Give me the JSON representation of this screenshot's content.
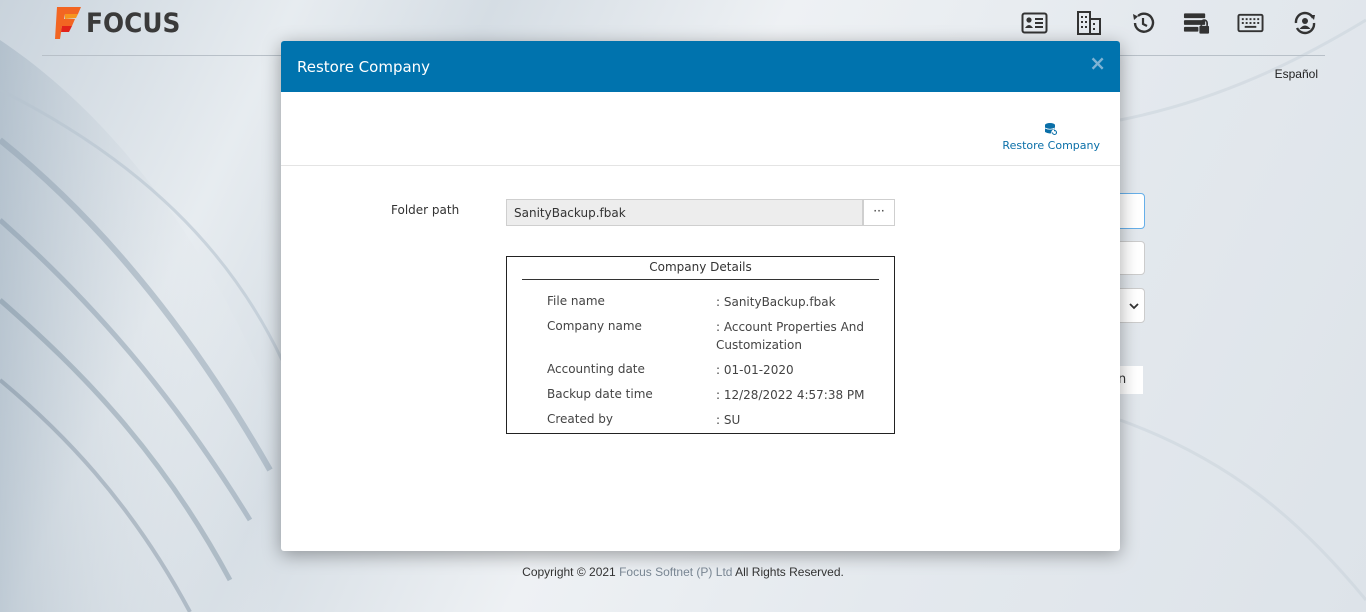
{
  "app": {
    "logo_text": "FOCUS",
    "language_link": "Español",
    "header_icons": [
      "contact-card-icon",
      "building-icon",
      "history-icon",
      "server-lock-icon",
      "keyboard-icon",
      "user-sync-icon"
    ]
  },
  "background_form": {
    "button_fragment": "n"
  },
  "footer": {
    "copyright_prefix": "Copyright © 2021 ",
    "brand": "Focus Softnet (P) Ltd",
    "copyright_suffix": " All Rights Reserved."
  },
  "modal": {
    "title": "Restore Company",
    "close_label": "×",
    "toolbar": {
      "restore_label": "Restore Company",
      "restore_icon": "database-restore-icon"
    },
    "folder_path": {
      "label": "Folder path",
      "value": "SanityBackup.fbak",
      "browse_label": "···"
    },
    "details": {
      "title": "Company Details",
      "rows": [
        {
          "label": "File name",
          "value": ": SanityBackup.fbak"
        },
        {
          "label": "Company name",
          "value": ": Account Properties And Customization"
        },
        {
          "label": "Accounting date",
          "value": ": 01-01-2020"
        },
        {
          "label": "Backup date time",
          "value": ": 12/28/2022 4:57:38 PM"
        },
        {
          "label": "Created by",
          "value": ": SU"
        }
      ]
    }
  },
  "colors": {
    "modal_header": "#0073ae",
    "accent_link": "#0a6fa8",
    "logo_orange": "#f26522"
  }
}
